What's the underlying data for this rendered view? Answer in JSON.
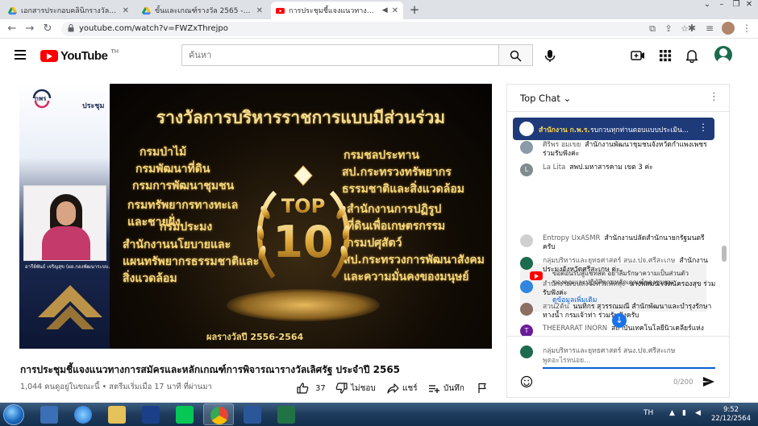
{
  "browser": {
    "tabs": [
      {
        "title": "เอกสารประกอบคลินิกรางวัล - Google",
        "icon": "google-drive-icon",
        "active": false
      },
      {
        "title": "ขั้นและเกณฑ์รางวัล 2565 - Google ไดร",
        "icon": "google-drive-icon",
        "active": false
      },
      {
        "title": "การประชุมชี้แจงแนวทางการสมัครแ",
        "icon": "youtube-icon",
        "active": true
      }
    ],
    "url": "youtube.com/watch?v=FWZxThrejpo"
  },
  "youtube": {
    "logo_text": "YouTube",
    "country_code": "TH",
    "search_placeholder": "ค้นหา"
  },
  "video": {
    "slide": {
      "headline": "รางวัลการบริหารราชการแบบมีส่วนร่วม",
      "left_items": [
        "กรมป่าไม้",
        "กรมพัฒนาที่ดิน",
        "กรมการพัฒนาชุมชน",
        "กรมทรัพยากรทางทะเล",
        "และชายฝั่ง",
        "กรมประมง",
        "สำนักงานนโยบายและ",
        "แผนทรัพยากรธรรมชาติและ",
        "สิ่งแวดล้อม"
      ],
      "right_items": [
        "กรมชลประทาน",
        "สป.กระทรวงทรัพยากร",
        "ธรรมชาติและสิ่งแวดล้อม",
        "สำนักงานการปฏิรูป",
        "ที่ดินเพื่อเกษตรกรรม",
        "กรมปศุสัตว์",
        "สป.กระทรวงการพัฒนาสังคม",
        "และความมั่นคงของมนุษย์"
      ],
      "badge_top": "TOP",
      "badge_num": "10",
      "award_years": "ผลรางวัลปี 2556-2564"
    },
    "org_short": "กพร",
    "meeting_label": "ประชุม",
    "speaker_caption": "อารีย์พันธ์ เจริญสุข (ผอ.กองพัฒนาระบบ...)",
    "title": "การประชุมชี้แจงแนวทางการสมัครและหลักเกณฑ์การพิจารณารางวัลเลิศรัฐ ประจำปี 2565",
    "meta": "1,044 คนดูอยู่ในขณะนี้ • สตรีมเริ่มเมื่อ 17 นาที ที่ผ่านมา",
    "likes": "37",
    "dislike_label": "ไม่ชอบ",
    "share_label": "แชร์",
    "save_label": "บันทึก"
  },
  "chat": {
    "header": "Top Chat",
    "pinned": {
      "author": "สำนักงาน ก.พ.ร.",
      "message": "รบกวนทุกท่านตอบแบบประเมิน..."
    },
    "messages": [
      {
        "author": "ศิริพร อมเขย",
        "text": "สำนักงานพัฒนาชุมชนจังหวัดกำแพงเพชร ร่วมรับฟังค่ะ",
        "avatar_color": "#8a9aa8"
      },
      {
        "author": "La Lita",
        "text": "สพป.มหาสารคาม เขต 3 ค่ะ",
        "avatar_color": "#7f8c8d",
        "initial": "L"
      },
      {
        "author": "Entropy UxASMR",
        "text": "สำนักงานปลัดสำนักนายกรัฐมนตรี ครับ",
        "avatar_color": "#d0d0d0"
      },
      {
        "author": "กลุ่มบริหารและยุทธศาสตร์ สนง.ปจ.ศรีสะเกษ",
        "text": "สำนักงานประมงจังหวัดศรีสะเกษ ค่ะ",
        "avatar_color": "#1c6b4c"
      },
      {
        "author": "สำนักงานขนส่งจังหวัดพัทลุง",
        "text": "นางพสมน เจตนัครองสุข ร่วมรับฟังค่ะ",
        "avatar_color": "#2e86de"
      },
      {
        "author": "สวน2ต้น",
        "text": "นนทิกร สุวรรณมณี สำนักพัฒนาและบำรุงรักษาทางน้ำ กรมเจ้าท่า ร่วมรับฟังครับ",
        "avatar_color": "#8d6e63"
      },
      {
        "author": "THEERARAT INORN",
        "text": "สถาบันเทคโนโลยีนิวเคลียร์แห่ง",
        "avatar_color": "#6a1b9a",
        "initial": "T"
      }
    ],
    "notice_text": "ขอต้อนรับสู่แชทสด อย่าลืมรักษาความเป็นส่วนตัวของคุณและปฏิบัติตามหลักเกณฑ์ของชุมชน",
    "notice_link": "ดูข้อมูลเพิ่มเติม",
    "input_user": "กลุ่มบริหารและยุทธศาสตร์ สนง.ปจ.ศรีสะเกษ",
    "input_placeholder": "พูดอะไรหน่อย...",
    "char_count": "0/200"
  },
  "taskbar": {
    "language": "TH",
    "time": "9:52",
    "date": "22/12/2564"
  }
}
